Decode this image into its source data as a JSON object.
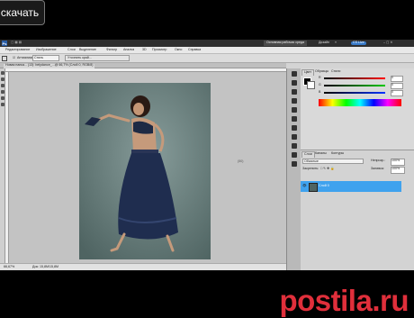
{
  "overlay": {
    "download_label": "скачать"
  },
  "app": {
    "logo": "Ps",
    "workspace_label": "Основная рабочая среда",
    "design_label": "Дизайн",
    "cs_live_label": "CS Live"
  },
  "menu": [
    "Редактирование",
    "Изображение",
    "Слои",
    "Выделение",
    "Фильтр",
    "Анализ",
    "3D",
    "Просмотр",
    "Окно",
    "Справка"
  ],
  "options": {
    "antialias_label": "Антиалиас",
    "style_value": "Стиль",
    "refine_edge_label": "Уточнить край..."
  },
  "doc_tab_label": "Новая папка... (13): belydance_...@ 66,7% (Слой 0, RGB/8)",
  "canvas": {
    "scratch_label": "(50)"
  },
  "status": {
    "zoom": "66,67%",
    "doc_size": "Док: 15,8М/15,8М"
  },
  "color_panel": {
    "tabs": [
      "Цвет",
      "Образцы",
      "Стили"
    ],
    "rows": [
      {
        "label": "R",
        "value": "0",
        "color": "#c0282c"
      },
      {
        "label": "G",
        "value": "0",
        "color": "#2d9a32"
      },
      {
        "label": "B",
        "value": "0",
        "color": "#2f55c8"
      }
    ]
  },
  "layers_panel": {
    "tabs": [
      "Слои",
      "Каналы",
      "Контуры"
    ],
    "blend_mode": "Обычные",
    "opacity_label": "Непрозр.:",
    "opacity_value": "100%",
    "lock_label": "Закрепить:",
    "fill_label": "Заливка:",
    "fill_value": "100%",
    "layers": [
      {
        "name": "Слой 0"
      }
    ]
  },
  "watermark": "postila.ru",
  "colors": {
    "app_bar": "#2e2e2e",
    "canvas_bg": "#c3c3c3",
    "selected_layer": "#3fa2ee",
    "watermark": "#e02f3b"
  }
}
